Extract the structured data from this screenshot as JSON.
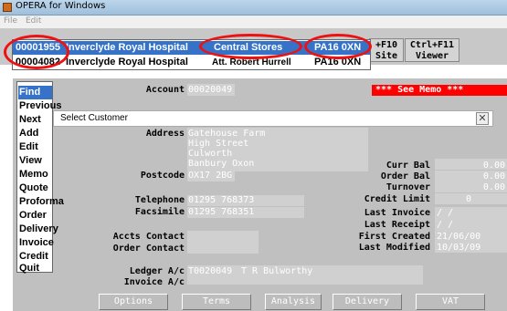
{
  "window": {
    "title": "OPERA for Windows"
  },
  "menubar": {
    "file": "File",
    "edit": "Edit"
  },
  "fkeys": [
    {
      "top": "+F10",
      "bottom": "Site"
    },
    {
      "top": "Ctrl+F11",
      "bottom": "Viewer"
    }
  ],
  "dropdown": {
    "rows": [
      {
        "code": "00001955",
        "name": "Inverclyde Royal Hospital",
        "contact": "Central Stores",
        "postcode": "PA16 0XN",
        "selected": true
      },
      {
        "code": "00004082",
        "name": "Inverclyde Royal Hospital",
        "contact": "Att. Robert Hurrell",
        "postcode": "PA16 0XN",
        "selected": false
      }
    ]
  },
  "menu": [
    "Find",
    "Previous",
    "Next",
    "Add",
    "Edit",
    "View",
    "Memo",
    "Quote",
    "Proforma",
    "Order",
    "Delivery",
    "Invoice",
    "Credit",
    "Quit"
  ],
  "dialog": {
    "title": "Select Customer"
  },
  "memo": "***  See Memo   ***",
  "form": {
    "account_label": "Account",
    "account_value": "00020049",
    "address_label": "Address",
    "address_lines": [
      "Gatehouse Farm",
      "High Street",
      "Culworth",
      "Banbury  Oxon"
    ],
    "postcode_label": "Postcode",
    "postcode_value": "OX17 2BG",
    "telephone_label": "Telephone",
    "telephone_value": "01295 768373",
    "facsimile_label": "Facsimile",
    "facsimile_value": "01295 768351",
    "accts_contact_label": "Accts Contact",
    "order_contact_label": "Order Contact",
    "ledger_label": "Ledger A/c",
    "ledger_code": "T0020049",
    "ledger_name": "T R Bulworthy",
    "invoice_label": "Invoice A/c"
  },
  "balances": [
    {
      "label": "Curr Bal",
      "value": "0.00"
    },
    {
      "label": "Order Bal",
      "value": "0.00"
    },
    {
      "label": "Turnover",
      "value": "0.00"
    },
    {
      "label": "Credit Limit",
      "value": "0"
    },
    {
      "label": "Last Invoice",
      "value": "/  /"
    },
    {
      "label": "Last Receipt",
      "value": "/  /"
    },
    {
      "label": "First Created",
      "value": "21/06/00"
    },
    {
      "label": "Last Modified",
      "value": "10/03/09"
    }
  ],
  "buttons": [
    "Options",
    "Terms",
    "Analysis",
    "Delivery",
    "VAT"
  ],
  "colors": {
    "highlight": "#3572c8",
    "annotation": "#ee1111",
    "memo_bg": "#ff0000"
  }
}
